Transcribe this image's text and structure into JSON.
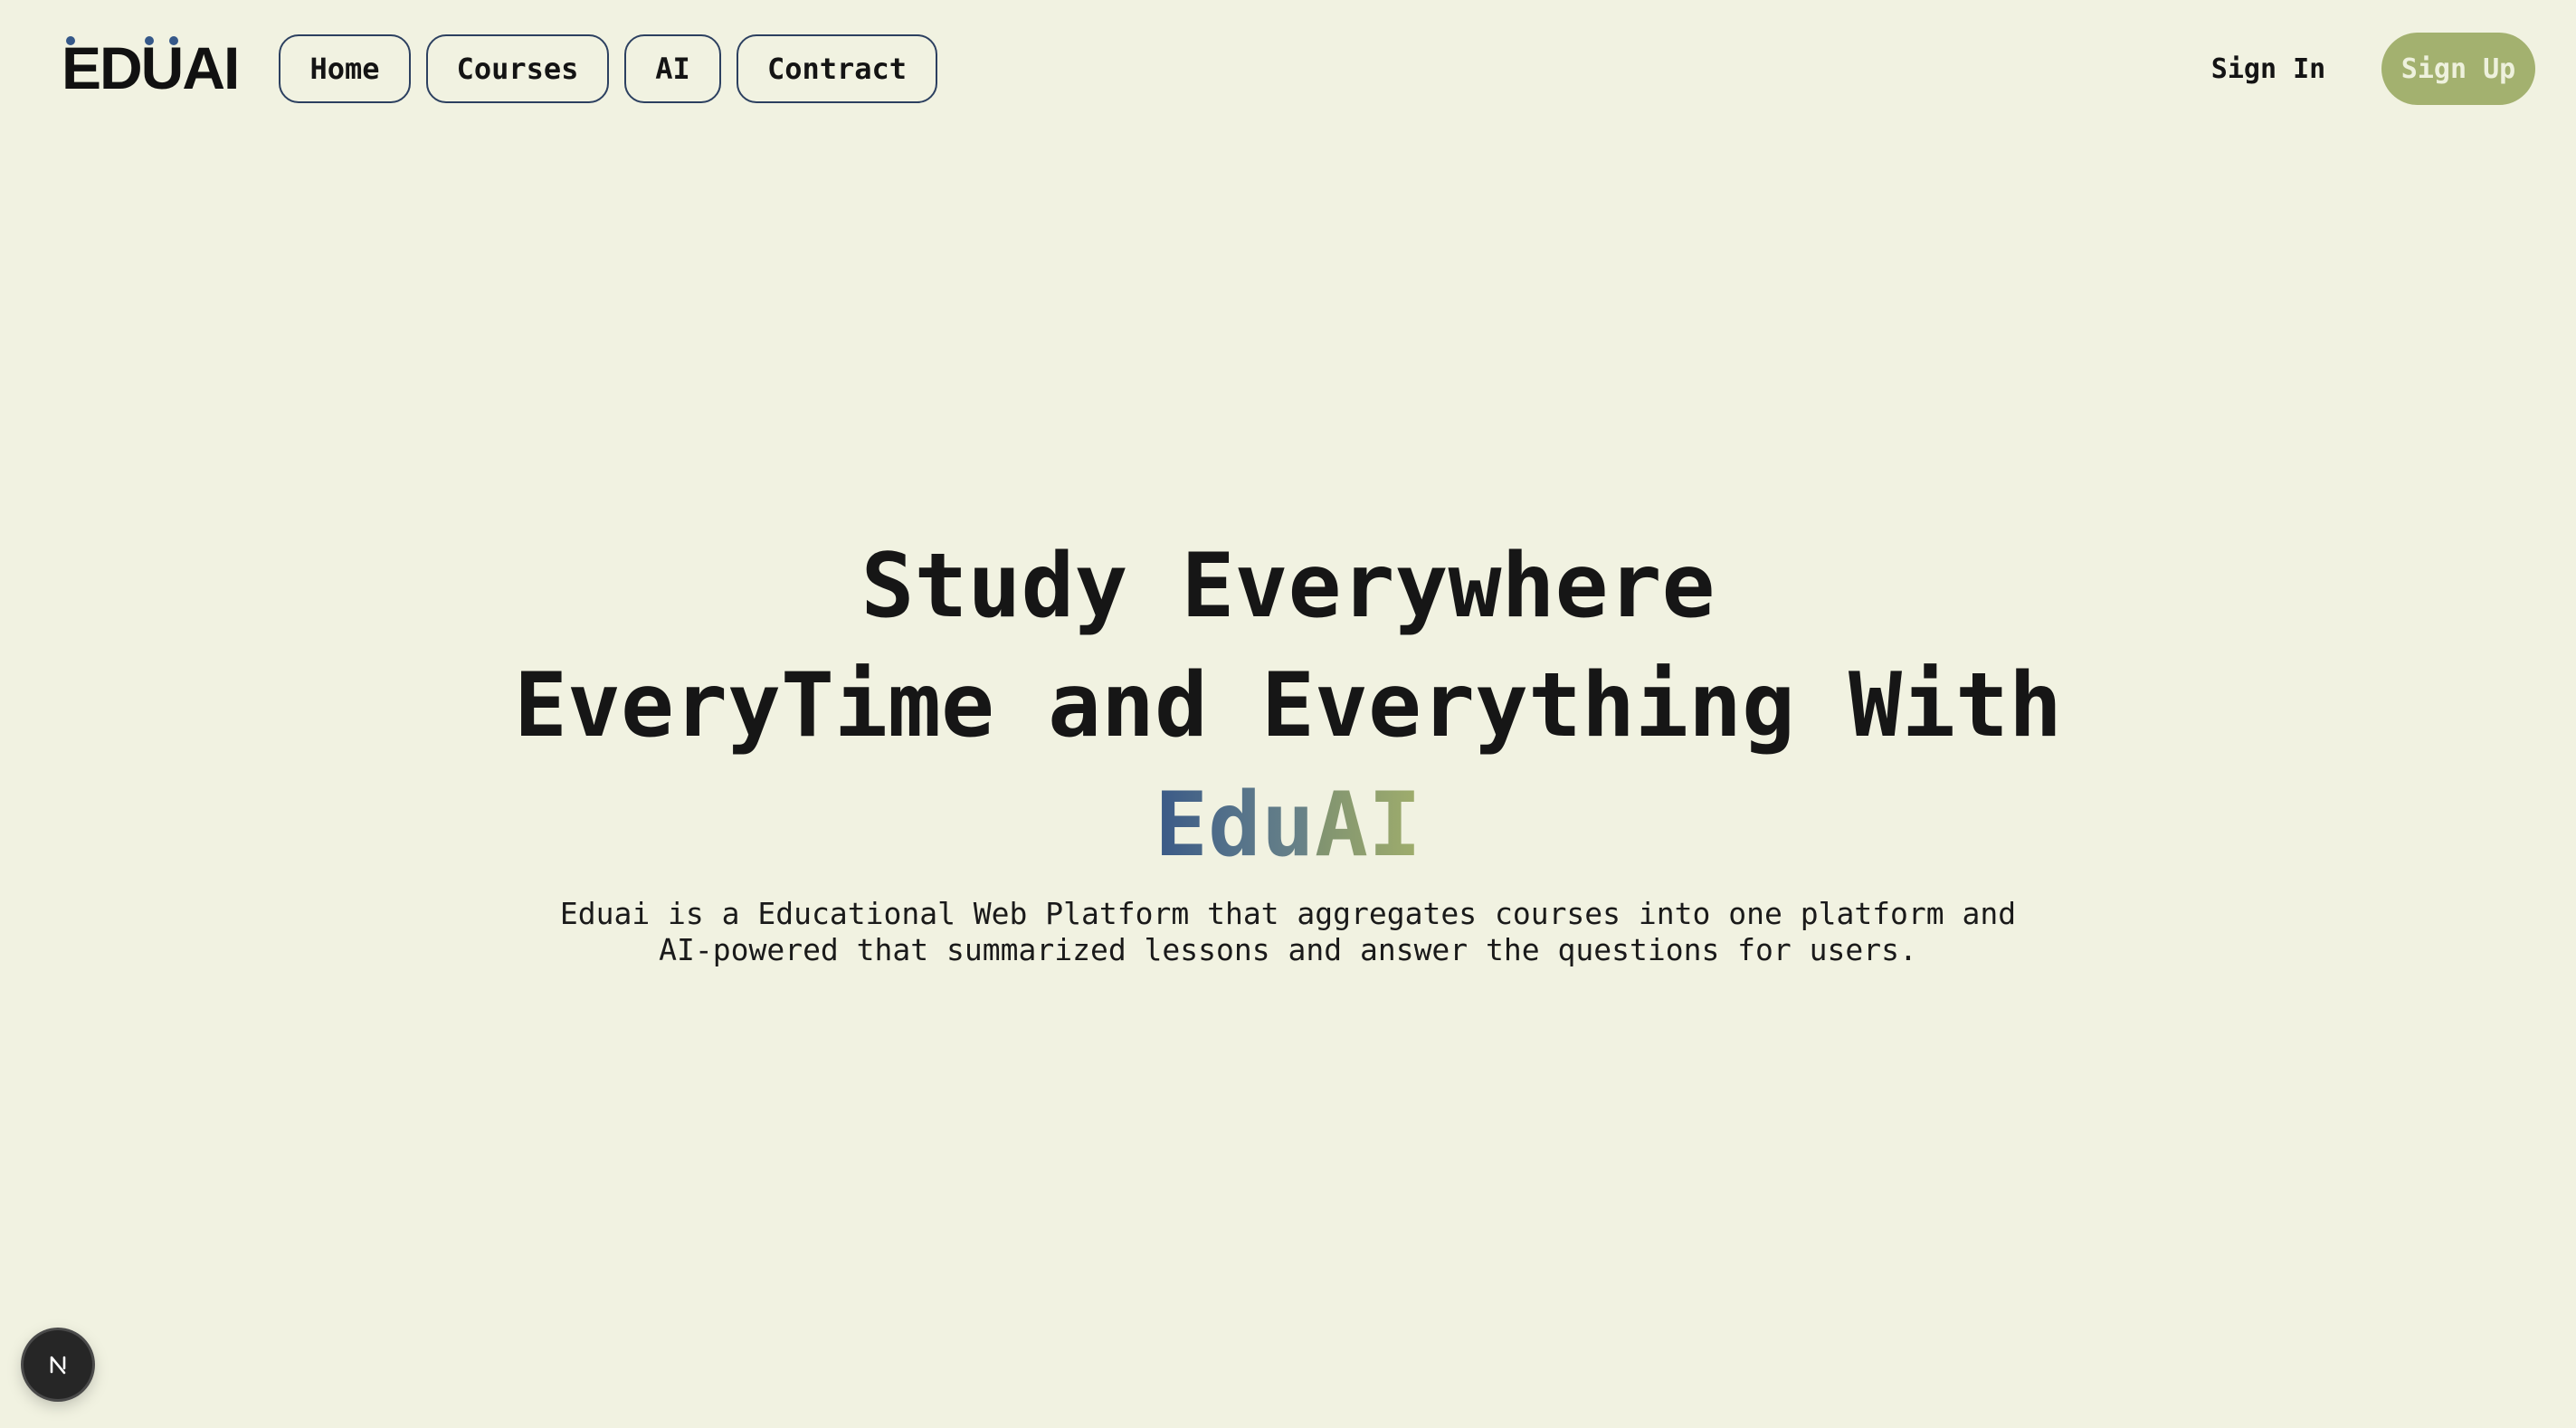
{
  "brand": {
    "logo_text": "EDUAI"
  },
  "nav": {
    "links": [
      {
        "label": "Home"
      },
      {
        "label": "Courses"
      },
      {
        "label": "AI"
      },
      {
        "label": "Contract"
      }
    ],
    "sign_in": "Sign In",
    "sign_up": "Sign Up"
  },
  "hero": {
    "line1": "Study Everywhere",
    "line2": "EveryTime and Everything With",
    "brand_edu": "Edu",
    "brand_ai": "AI",
    "desc_line1": "Eduai is a Educational Web Platform that aggregates courses into one platform and",
    "desc_line2": "AI-powered that summarized lessons and answer the questions for users."
  },
  "badge": {
    "icon": "n-logo-icon"
  },
  "colors": {
    "background": "#f1f2e1",
    "accent_green": "#a3b16f",
    "accent_blue": "#355889",
    "nav_border": "#2c4060"
  }
}
